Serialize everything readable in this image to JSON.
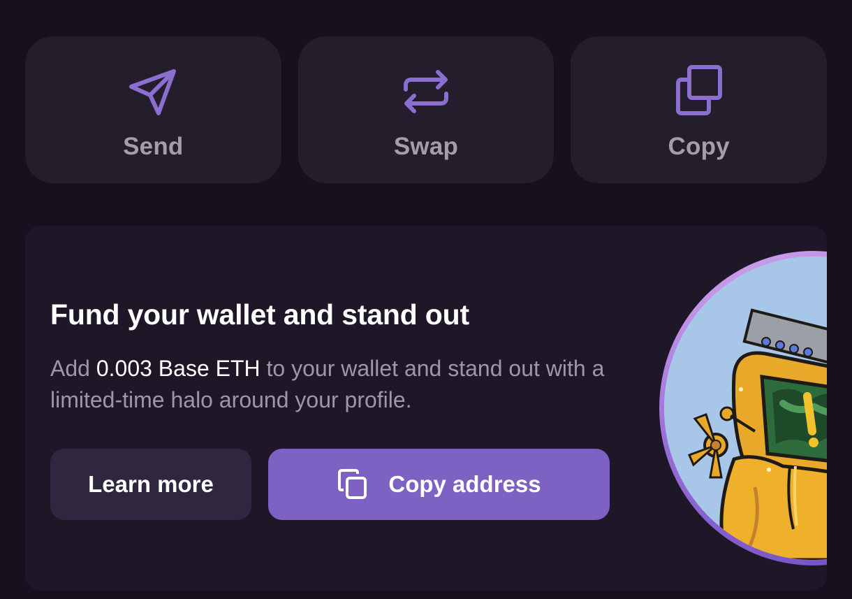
{
  "actions": [
    {
      "label": "Send",
      "icon": "send-icon"
    },
    {
      "label": "Swap",
      "icon": "swap-icon"
    },
    {
      "label": "Copy",
      "icon": "copy-icon"
    }
  ],
  "promo": {
    "title": "Fund your wallet and stand out",
    "description": {
      "before": "Add ",
      "highlight": "0.003 Base ETH",
      "after": " to your wallet and stand out with a limited-time halo around your profile."
    },
    "learn_more_label": "Learn more",
    "copy_address_label": "Copy address",
    "image": "robot-avatar-with-halo"
  },
  "colors": {
    "background": "#17111f",
    "card": "#241e2c",
    "accent": "#7d62c4",
    "icon": "#8a6fd0"
  }
}
